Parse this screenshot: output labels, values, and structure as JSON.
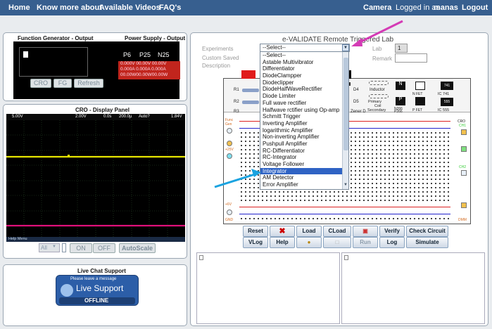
{
  "nav": {
    "home": "Home",
    "know_more": "Know more about",
    "videos": "Available Videos",
    "faq": "FAQ's",
    "camera": "Camera",
    "logged_in": "Logged in as",
    "username": "manas",
    "logout": "Logout"
  },
  "function_generator": {
    "title": "Function Generator - Output",
    "buttons": [
      "CRO",
      "FG",
      "Refresh"
    ]
  },
  "power_supply": {
    "title": "Power Supply - Output",
    "labels": [
      "P6",
      "P25",
      "N25"
    ],
    "volts": [
      "0.000V",
      "00.00V",
      "00.00V"
    ],
    "amps": [
      "0.000A",
      "0.000A",
      "0.000A"
    ],
    "watts": [
      "00.00W",
      "00.00W",
      "00.00W"
    ]
  },
  "cro": {
    "title": "CRO - Display Panel",
    "readouts": [
      "5.00V",
      "2.00V",
      "0.0s",
      "200.0µ",
      "Auto?",
      "1.84V"
    ],
    "help_menu": "Help Menu",
    "select_value": "All",
    "buttons": [
      "ON",
      "OFF",
      "AutoScale"
    ]
  },
  "live_chat": {
    "title": "Live Chat Support",
    "leave_message": "Please leave a message",
    "live_support": "Live Support",
    "status": "OFFLINE"
  },
  "lab": {
    "title": "e-VALIDATE Remote Triggered Lab",
    "experiments_label": "Experiments",
    "custom_saved_label": "Custom Saved",
    "description_label": "Description",
    "lab_label": "Lab",
    "lab_value": "1",
    "remark_label": "Remark",
    "select_value": "--Select--"
  },
  "dropdown": {
    "options": [
      "--Select--",
      "Astable Multivibrator",
      "Differentiator",
      "DiodeClampper",
      "Diodeclipper",
      "DiodeHalfWaveRectifier",
      "Diode Limiter",
      "Full wave rectifier",
      "Halfwave rctifier using Op-amp",
      "Schmitt Trigger",
      "Inverting Amplifier",
      "logarithmic Amplifier",
      "Non-inverting Amplifier",
      "Pushpull Amplifier",
      "RC-Differentiator",
      "RC-Integrator",
      "Voltage Follower",
      "Integrator",
      "AM Detector",
      "Error Amplifier"
    ],
    "selected_index": 17
  },
  "board": {
    "left_labels": [
      "R1",
      "R2",
      "R3"
    ],
    "right_labels": [
      "D4",
      "D5",
      "Zener D"
    ],
    "inductor": "Inductor",
    "primary": "Primary",
    "coil": "Coil",
    "secondary": "Secondary",
    "transistors": [
      "N",
      "N FET",
      "P",
      "P FET"
    ],
    "n266": "N266",
    "p266": "P266",
    "ics": [
      "IC 741",
      "IC 555",
      "741",
      "555"
    ],
    "side_left": [
      "Func Gen",
      "+25V",
      "+6V",
      "GND"
    ],
    "side_right": [
      "CRO",
      "CH1",
      "CH2",
      "DMM"
    ]
  },
  "toolbar": {
    "row1": [
      "Reset",
      "Load",
      "CLoad",
      "Verify",
      "Check Circuit"
    ],
    "row2": [
      "VLog",
      "Help",
      "Run",
      "Log",
      "Simulate"
    ]
  },
  "colors": {
    "nav": "#375f8f",
    "select_highlight": "#2f63c4",
    "trace_yellow": "#e6e600",
    "trace_pink": "#e0107a",
    "arrow_pink": "#d43bb5",
    "arrow_blue": "#1aa3e0"
  }
}
